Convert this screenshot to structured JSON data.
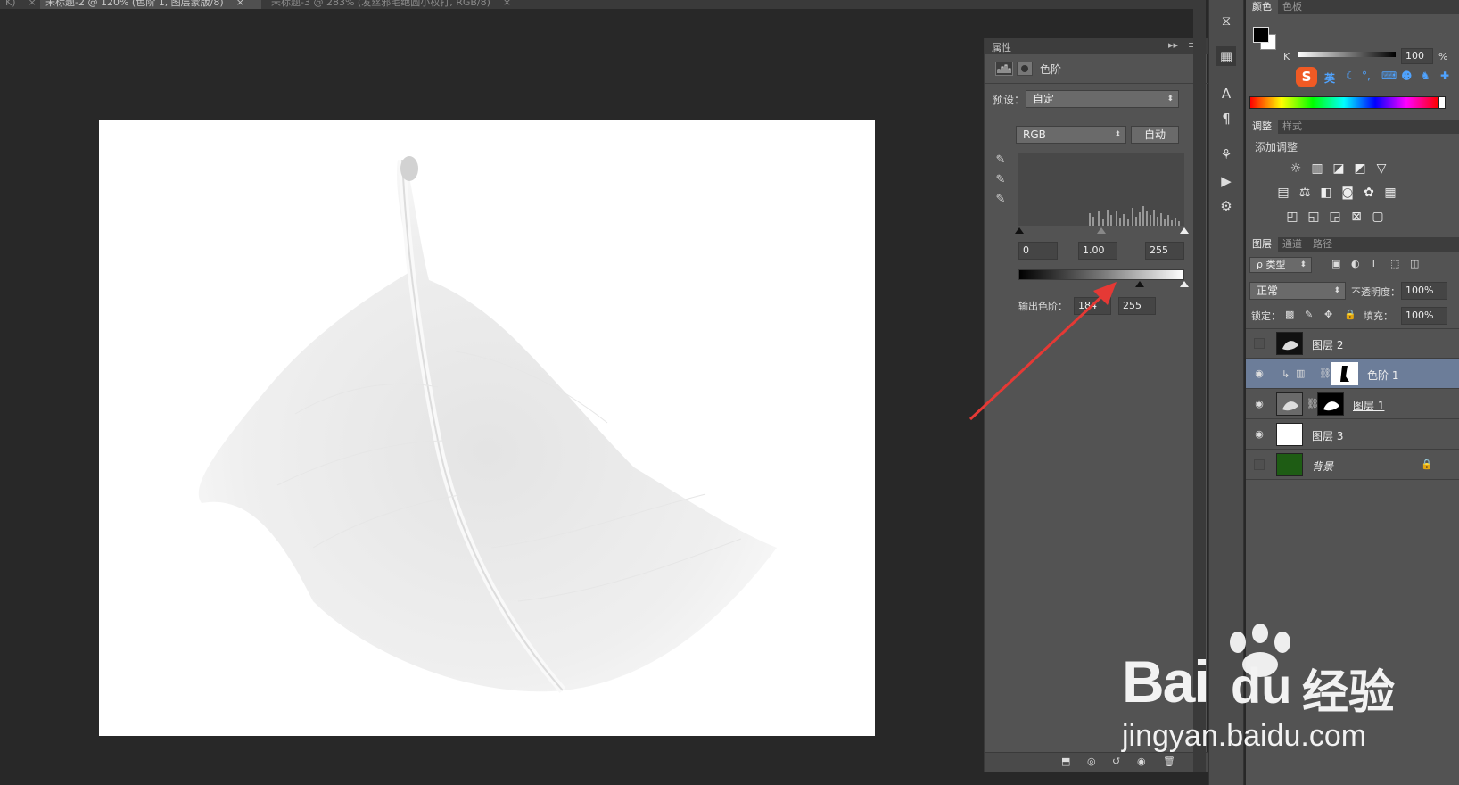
{
  "tabs": [
    {
      "label": "K)",
      "close": "×"
    },
    {
      "label": "未标题-2 @ 120% (色阶 1, 图层蒙版/8)",
      "close": "×"
    },
    {
      "label": "未标题-3 @ 283% (发丝邪毛绝圆小权打, RGB/8)",
      "close": "×"
    }
  ],
  "properties": {
    "title": "属性",
    "panel_label": "色阶",
    "preset_label": "预设：",
    "preset_value": "自定",
    "channel_value": "RGB",
    "auto_label": "自动",
    "input_black": "0",
    "input_gamma": "1.00",
    "input_white": "255",
    "output_label": "输出色阶：",
    "output_black": "184",
    "output_white": "255"
  },
  "color_panel": {
    "tabs": [
      "颜色",
      "色板"
    ],
    "channel_label": "K",
    "k_value": "100",
    "percent": "%",
    "ime_label": "英"
  },
  "adjust_panel": {
    "tabs": [
      "调整",
      "样式"
    ],
    "add_label": "添加调整"
  },
  "layers_panel": {
    "tabs": [
      "图层",
      "通道",
      "路径"
    ],
    "filter_label": "ρ 类型",
    "blend_mode": "正常",
    "opacity_label": "不透明度：",
    "opacity_value": "100%",
    "lock_label": "锁定：",
    "fill_label": "填充：",
    "fill_value": "100%",
    "layers": [
      {
        "name": "图层 2",
        "visible": false
      },
      {
        "name": "色阶 1",
        "visible": true
      },
      {
        "name": "图层 1",
        "visible": true
      },
      {
        "name": "图层 3",
        "visible": true
      },
      {
        "name": "背景",
        "visible": false
      }
    ]
  },
  "watermark": {
    "brand": "Bai",
    "brand2": "du",
    "cn": "经验",
    "url": "jingyan.baidu.com"
  },
  "colors": {
    "accent_arrow": "#e53935",
    "selected_layer": "#6c7d99",
    "background_layer": "#1e5c14"
  }
}
